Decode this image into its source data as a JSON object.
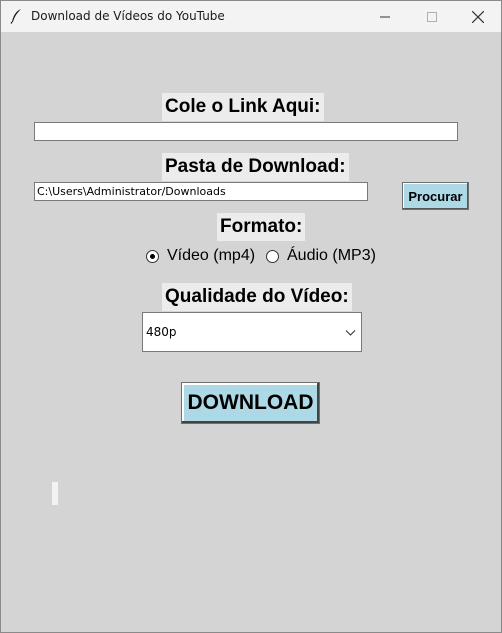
{
  "window": {
    "title": "Download de Vídeos do YouTube",
    "icon": "feather-icon"
  },
  "link": {
    "label": "Cole o Link Aqui:",
    "value": ""
  },
  "folder": {
    "label": "Pasta de Download:",
    "value": "C:\\Users\\Administrator/Downloads",
    "browse_label": "Procurar"
  },
  "format": {
    "label": "Formato:",
    "options": [
      {
        "label": "Vídeo (mp4)",
        "selected": true
      },
      {
        "label": "Áudio (MP3)",
        "selected": false
      }
    ]
  },
  "quality": {
    "label": "Qualidade do Vídeo:",
    "selected": "480p"
  },
  "download": {
    "label": "DOWNLOAD"
  },
  "progress": {
    "value": 0
  },
  "colors": {
    "background": "#d4d4d4",
    "button": "#add8e6"
  }
}
